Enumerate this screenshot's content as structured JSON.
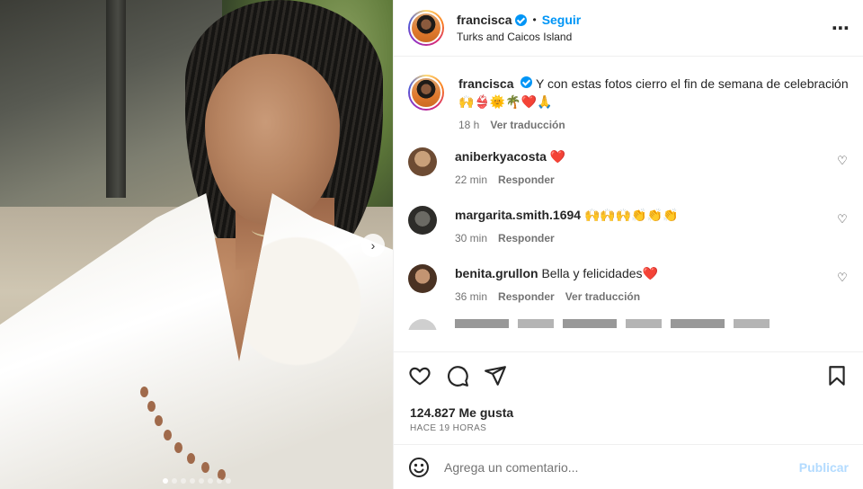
{
  "post": {
    "username": "francisca",
    "follow_label": "Seguir",
    "bullet": "•",
    "location": "Turks and Caicos Island",
    "more_icon": "more-options-icon"
  },
  "caption": {
    "username": "francisca",
    "text": "Y con estas fotos cierro el fin de semana de celebración",
    "emojis": [
      "🙌",
      "👙",
      "🌞",
      "🌴",
      "❤️",
      "🙏"
    ],
    "time": "18 h",
    "translate": "Ver traducción"
  },
  "comments": [
    {
      "username": "aniberkyacosta",
      "text": "",
      "emojis": [
        "❤️"
      ],
      "time": "22 min",
      "reply": "Responder",
      "translate": ""
    },
    {
      "username": "margarita.smith.1694",
      "text": "",
      "emojis": [
        "🙌",
        "🙌",
        "🙌",
        "👏",
        "👏",
        "👏"
      ],
      "time": "30 min",
      "reply": "Responder",
      "translate": ""
    },
    {
      "username": "benita.grullon",
      "text": "Bella y felicidades",
      "emojis": [
        "❤️"
      ],
      "time": "36 min",
      "reply": "Responder",
      "translate": "Ver traducción"
    }
  ],
  "actions": {
    "like_icon": "heart-icon",
    "comment_icon": "comment-icon",
    "share_icon": "share-icon",
    "save_icon": "bookmark-icon"
  },
  "likes": "124.827 Me gusta",
  "time_ago": "HACE 19 HORAS",
  "composer": {
    "placeholder": "Agrega un comentario...",
    "post_label": "Publicar"
  },
  "carousel": {
    "dots_total": 8,
    "active_index": 0
  },
  "colors": {
    "accent": "#0095f6",
    "text": "#262626",
    "muted": "#737373",
    "post_disabled": "#b3dbff",
    "heart_red": "#e0245e"
  }
}
